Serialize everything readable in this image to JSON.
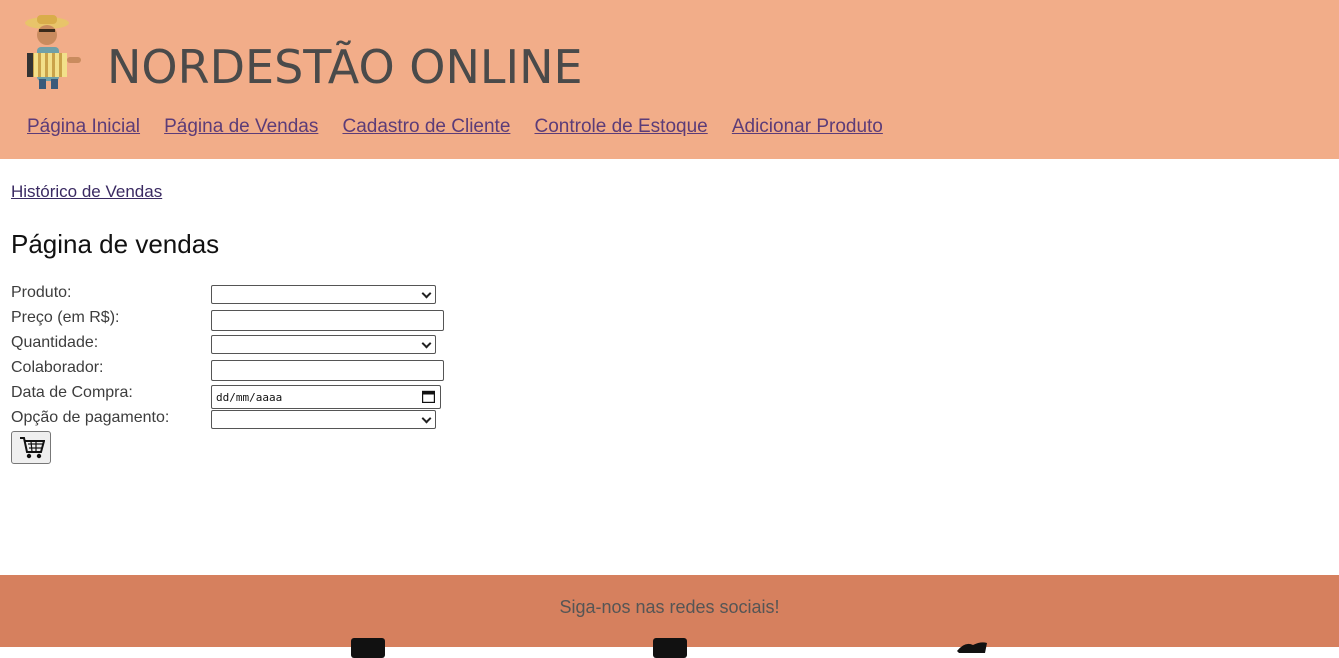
{
  "header": {
    "brand": "NORDESTÃO ONLINE",
    "logo_icon": "accordion-player-icon",
    "nav": [
      {
        "label": "Página Inicial"
      },
      {
        "label": "Página de Vendas"
      },
      {
        "label": "Cadastro de Cliente"
      },
      {
        "label": "Controle de Estoque"
      },
      {
        "label": "Adicionar Produto"
      }
    ]
  },
  "main": {
    "history_link": "Histórico de Vendas",
    "title": "Página de vendas",
    "form": {
      "produto_label": "Produto:",
      "preco_label": "Preço (em R$):",
      "quantidade_label": "Quantidade:",
      "colaborador_label": "Colaborador:",
      "data_label": "Data de Compra:",
      "data_placeholder": "dd/mm/aaaa",
      "pagamento_label": "Opção de pagamento:",
      "submit_icon": "shopping-cart-icon"
    }
  },
  "footer": {
    "follow_text": "Siga-nos nas redes sociais!",
    "social_icons": [
      "facebook-icon",
      "instagram-icon",
      "twitter-icon"
    ]
  },
  "colors": {
    "header_bg": "#f2ad89",
    "footer_bg": "#d6805e",
    "link": "#5c3c78"
  }
}
